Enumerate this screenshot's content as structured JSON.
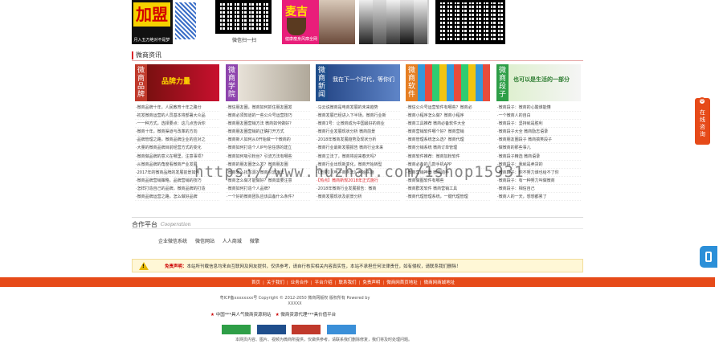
{
  "top_ads": {
    "join_big": "加盟",
    "join_small": "月入五万绝对不是梦",
    "qr2_caption": "微信扫一扫",
    "shop_title": "麦吉",
    "shop_caption": "健康瘦身风靡全网"
  },
  "section": {
    "title": "微商资讯"
  },
  "columns": [
    {
      "label": "微商品牌",
      "banner_text": "品牌力量",
      "color": "#c0392b",
      "items": [
        "·微商品牌十年，人民教育十年之路分",
        "·初发微商运营的人员基本将部署大众品",
        "·一一种方式，选择要点：这几点告诉你",
        "·微商十年，微商渠道与改革的方向",
        "·品牌管理之路，微商品牌企业的应对之",
        "·大量的微商品牌目前经营方式的变化",
        "·微商做品牌的意义在哪里，注意事项？",
        "·从微商品牌的角度看微商产业发展",
        "·2017年的微商品牌的发展前景如何",
        "·微商品牌营销策略，品牌营销的技巧",
        "·怎样打造自己的品牌，微商品牌的打造",
        "·微商品牌运营之路，怎么做好品牌"
      ]
    },
    {
      "label": "微商学院",
      "banner_text": "",
      "color": "#8e44ad",
      "items": [
        "·微信朋友圈，微商如何抓住朋友圈发",
        "·微商必须知道的一些公众号运营技巧",
        "·微商朋友圈营销方法 微商如何做好？",
        "·微商朋友圈营销的正确打开方式",
        "·微商新人如何从0开始做一个微商的",
        "·微商如何打造个人IP与信任感的建立",
        "·微商如何吸引粉丝？引流方法有哪些",
        "·微商的朋友圈怎么发？微商朋友圈",
        "·微商怎么找客源？微商引流方法",
        "·微商怎么做才能做好？微商需要注意",
        "·微商如何打造个人品牌？",
        "·一个好的微商团队应该具备什么条件？"
      ]
    },
    {
      "label": "微商新闻",
      "banner_text": "我在下一个时代，等你们",
      "color": "#1f4e8c",
      "items": [
        "·马云说微商是电商发展的未来趋势",
        "·微商发展已经进入下半场，微商行业新",
        "·微商1号：让微商成为中国最好的商业",
        "·微商行业发展现状分析 微商前景",
        "·2018年微商发展趋势及现状分析",
        "·微商行业最新发展报告 微商行业未来",
        "·微商立法了，微商将迎来春天吗？",
        "·微商行业出现新变化，微商开始转型",
        "·【重要】《电子商务法》开始实施",
        "·【热点】微商新规2018年正式施行",
        "·2018年微商行业发展报告：微商",
        "·微商发展现状及前景分析"
      ]
    },
    {
      "label": "微商软件",
      "banner_text": "",
      "color": "#e67e22",
      "items": [
        "·微信公众号运营软件有哪些？微商必",
        "·微商小程序怎么做？微商小程序",
        "·微商工具推荐 微商必备软件大全",
        "·微商营销软件哪个好？微商营销",
        "·微商管理系统怎么选？微商代理",
        "·微商分销系统 微商订单管理",
        "·微商软件推荐：微商加粉软件",
        "·微商必备的几款手机APP",
        "·微商营销神器 微商助手",
        "·微商做图软件有哪些",
        "·微商群发软件 微商营销工具",
        "·微商代理管理系统，一键代理管理"
      ]
    },
    {
      "label": "微商段子",
      "banner_text": "也可以是生活的一部分",
      "color": "#2e9e47",
      "items": [
        "·微商段子：微商的心酸谁能懂",
        "·一个微商人的自白",
        "·微商段子：坚持就是胜利",
        "·微商段子大全 微商励志语录",
        "·微商朋友圈段子 微商搞笑段子",
        "·做微商的那些事儿",
        "·微商段子精选 微商语录",
        "·微商段子：我就是卖货的",
        "·微商段子：你不努力谁也给不了你",
        "·微商段子：有一种努力叫做微商",
        "·微商段子：相信自己",
        "·微商人的一天，想想都累了"
      ]
    }
  ],
  "watermark": "https://www.huzhan.com/1shop15931",
  "cooperation": {
    "title": "合作平台",
    "title_en": "Cooperation",
    "links": [
      "企业微信系统",
      "微信网站",
      "人人商城",
      "微擎"
    ]
  },
  "notice": {
    "label": "免责声明：",
    "text": "本站所刊载信息均来自互联网及网友提供，仅供参考，请自行核实相关内容真实性，本站不承担任何法律责任，如有侵权，请联系我们删除！"
  },
  "footer_nav": [
    "首页",
    "关于我们",
    "业务合作",
    "平台介绍",
    "联系我们",
    "免责声明",
    "微商网首页地址",
    "微商网商城地址"
  ],
  "copyright": {
    "line1": "粤ICP备xxxxxxxx号   Copyright © 2012-2050  微商网版权  版权所有  Powered by",
    "line2": "XXXXX"
  },
  "badges": {
    "text1": "中国***具人气微商资源网站",
    "text2": "微商资源代理***具价值平台"
  },
  "bottom_note": "本网页内容、图片、视频为微商所提供，仅做供参考，请联系我们删除修复，我们将及时处理问题。",
  "side_float": {
    "text": "在线咨询",
    "dot": "o"
  }
}
